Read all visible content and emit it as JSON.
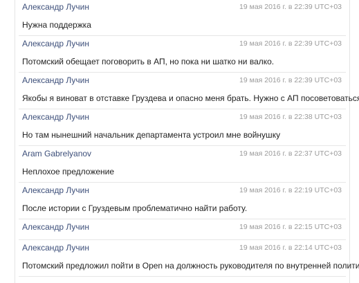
{
  "messages": [
    {
      "author": "Александр Лучин",
      "time": "19 мая 2016 г. в 22:39 UTC+03",
      "text": "Нужна поддержка"
    },
    {
      "author": "Александр Лучин",
      "time": "19 мая 2016 г. в 22:39 UTC+03",
      "text": "Потомский обещает поговорить в АП, но пока ни шатко ни валко."
    },
    {
      "author": "Александр Лучин",
      "time": "19 мая 2016 г. в 22:39 UTC+03",
      "text": "Якобы я виноват в отставке Груздева и опасно меня брать. Нужно с АП посоветоваться."
    },
    {
      "author": "Александр Лучин",
      "time": "19 мая 2016 г. в 22:38 UTC+03",
      "text": "Но там нынешний начальник департамента устроил мне войнушку"
    },
    {
      "author": "Aram Gabrelyanov",
      "time": "19 мая 2016 г. в 22:37 UTC+03",
      "text": "Неплохое предложение"
    },
    {
      "author": "Александр Лучин",
      "time": "19 мая 2016 г. в 22:19 UTC+03",
      "text": "После истории с Груздевым проблематично найти работу."
    },
    {
      "author": "Александр Лучин",
      "time": "19 мая 2016 г. в 22:15 UTC+03",
      "text": ""
    },
    {
      "author": "Александр Лучин",
      "time": "19 мая 2016 г. в 22:14 UTC+03",
      "text": "Потомский предложил пойти в Open на должность руководителя по внутренней политике."
    }
  ]
}
